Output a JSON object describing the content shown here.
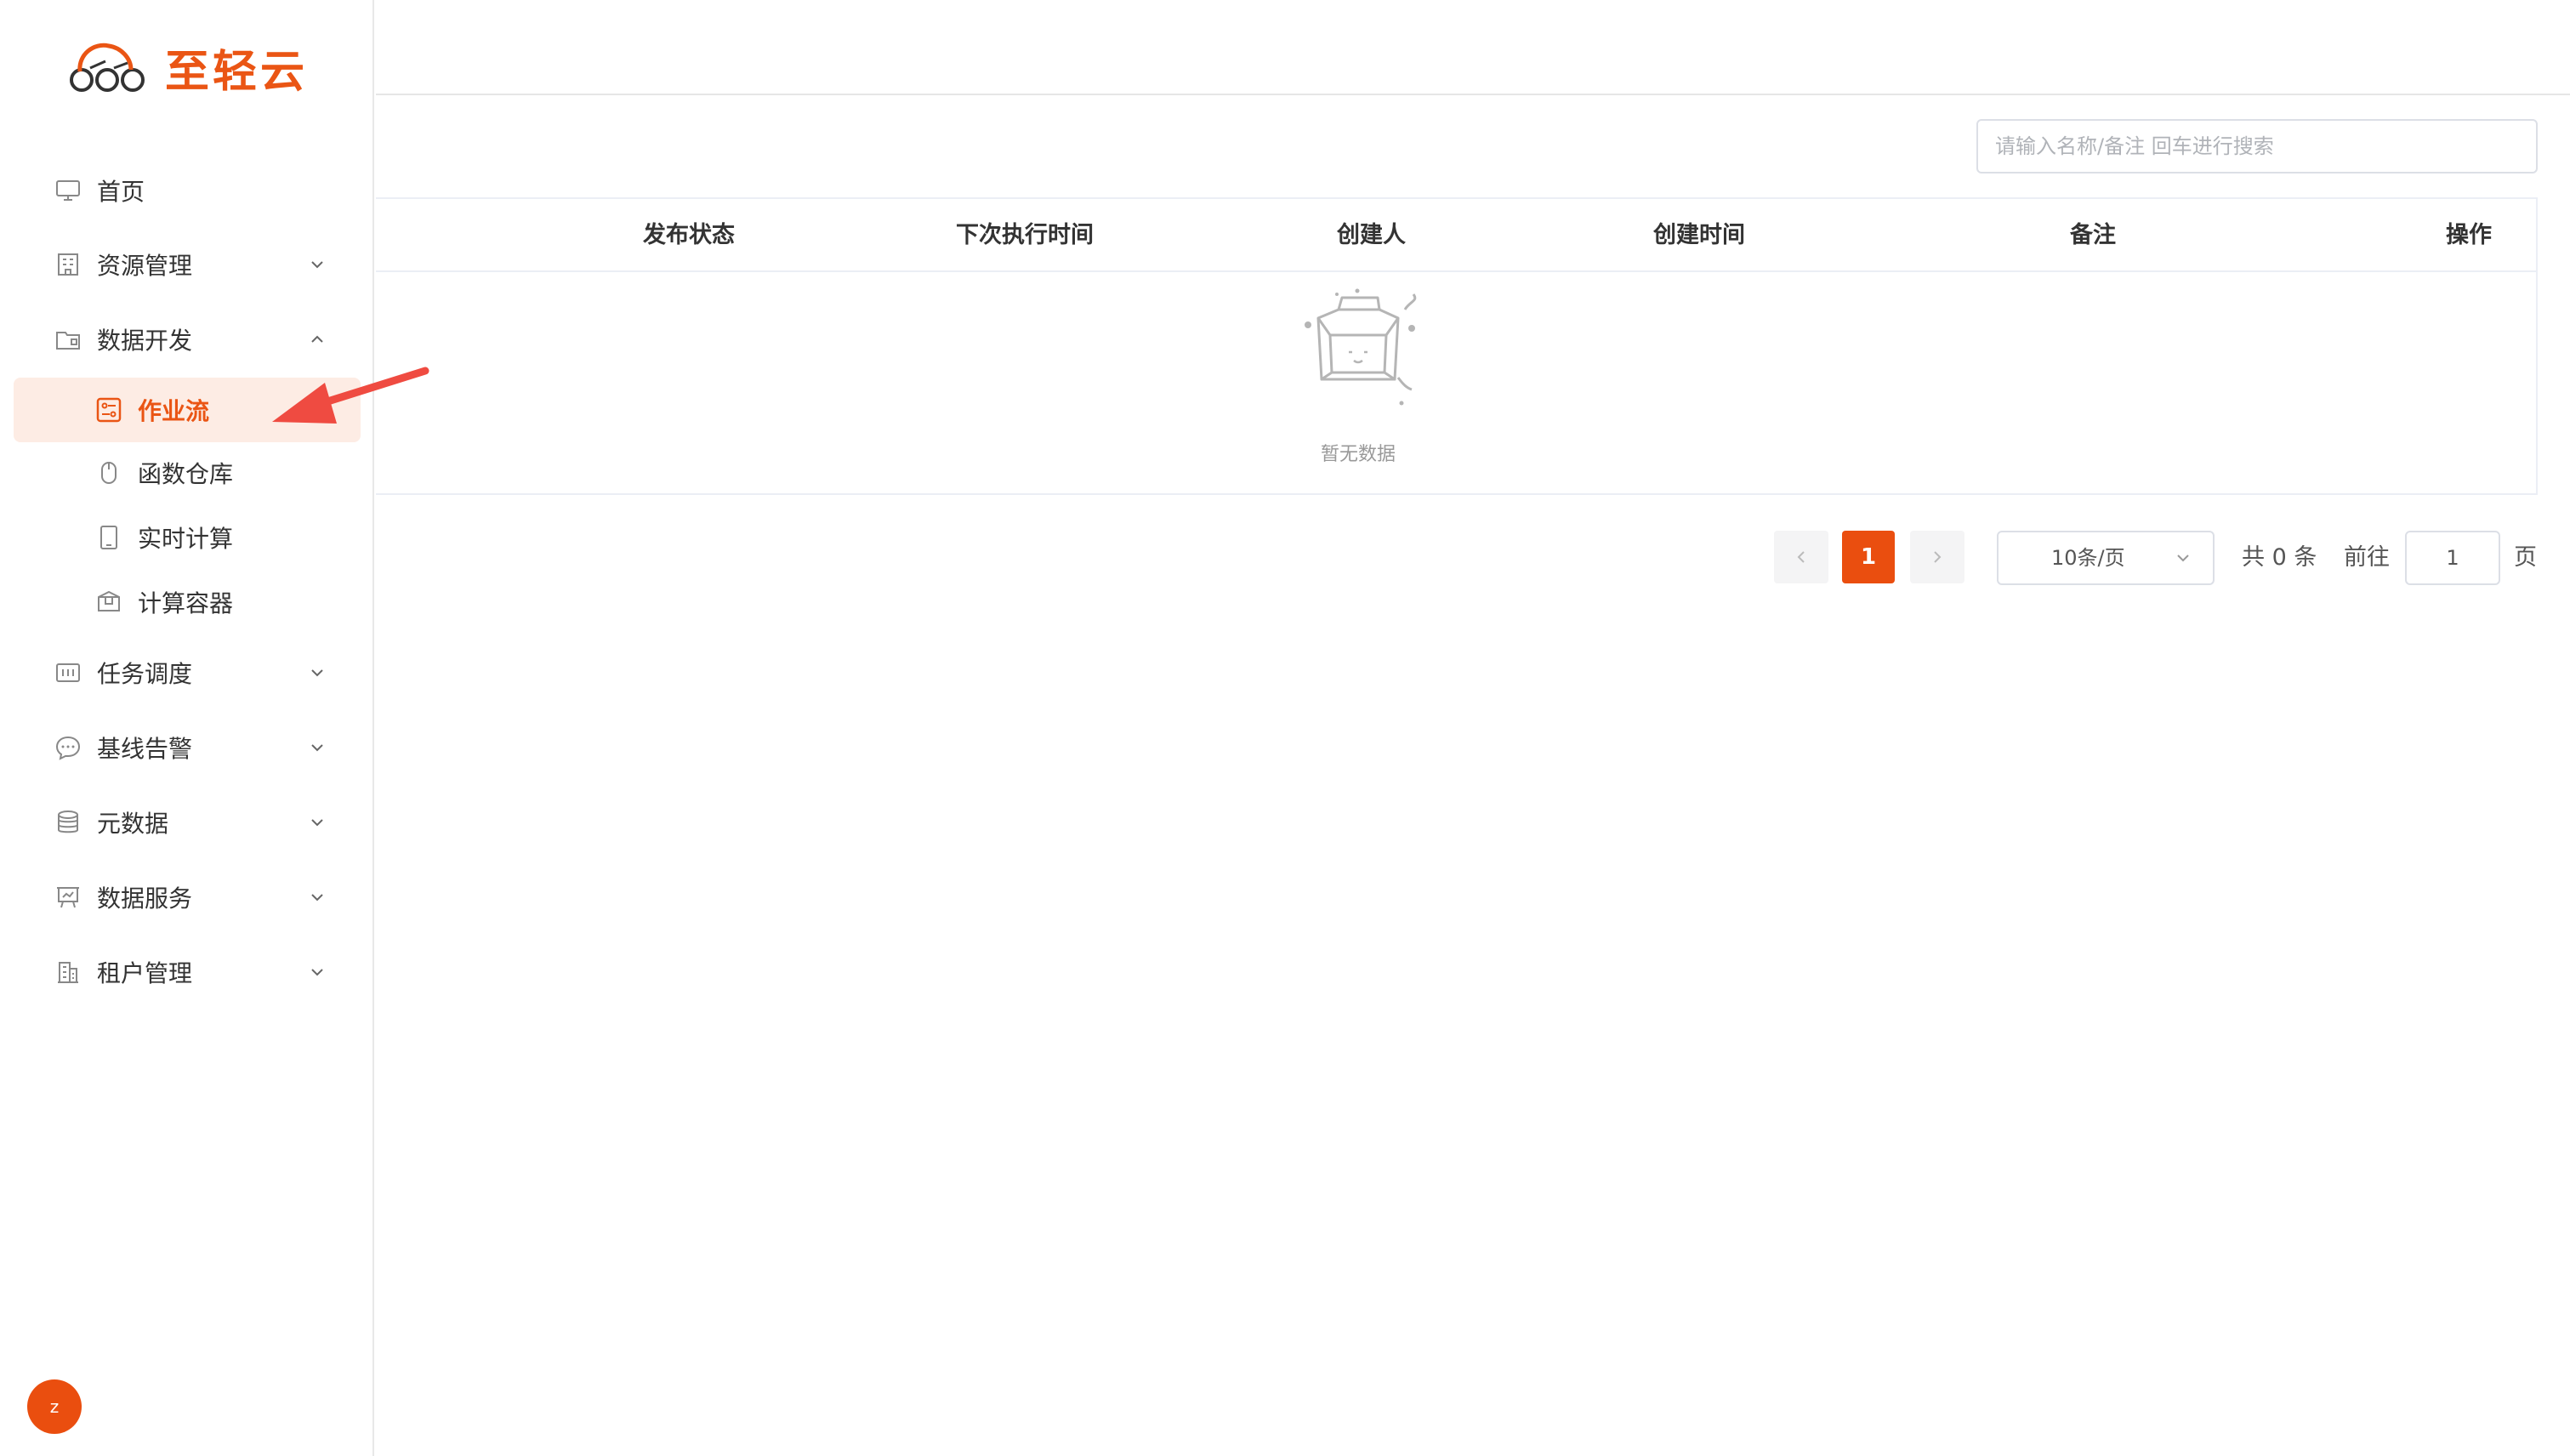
{
  "app": {
    "brand": "至轻云",
    "brand_color": "#ea5514"
  },
  "sidebar": {
    "items": [
      {
        "label": "首页",
        "icon": "monitor-icon"
      },
      {
        "label": "资源管理",
        "icon": "building-icon"
      },
      {
        "label": "数据开发",
        "icon": "folder-icon"
      },
      {
        "label": "任务调度",
        "icon": "schedule-icon"
      },
      {
        "label": "基线告警",
        "icon": "chat-icon"
      },
      {
        "label": "元数据",
        "icon": "database-icon"
      },
      {
        "label": "数据服务",
        "icon": "presentation-icon"
      },
      {
        "label": "租户管理",
        "icon": "office-icon"
      }
    ],
    "sub_items": [
      {
        "label": "作业流",
        "icon": "workflow-icon",
        "active": true
      },
      {
        "label": "函数仓库",
        "icon": "mouse-icon"
      },
      {
        "label": "实时计算",
        "icon": "tablet-icon"
      },
      {
        "label": "计算容器",
        "icon": "box-icon"
      }
    ],
    "avatar_letter": "z"
  },
  "main": {
    "search_placeholder": "请输入名称/备注 回车进行搜索",
    "table": {
      "columns": [
        "发布状态",
        "下次执行时间",
        "创建人",
        "创建时间",
        "备注",
        "操作"
      ],
      "rows": [],
      "empty_text": "暂无数据"
    },
    "pagination": {
      "current_page": "1",
      "page_size_label": "10条/页",
      "total_text": "共 0 条",
      "goto_label": "前往",
      "goto_value": "1",
      "page_suffix": "页"
    }
  }
}
